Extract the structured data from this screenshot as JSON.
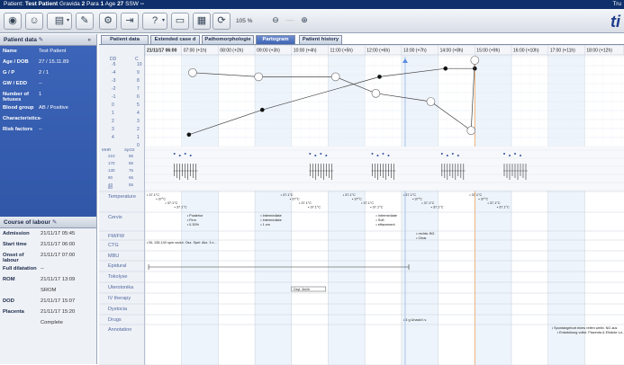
{
  "titlebar": {
    "prefix": "Patient: ",
    "name": "Test Patient",
    "g_label": "Gravida",
    "g": "2",
    "p_label": "Para",
    "p": "1",
    "age_label": "Age",
    "age": "27",
    "ssw_label": "SSW",
    "ssw": "--",
    "right": "Tru"
  },
  "toolbar": {
    "zoom": "105 %",
    "logo": "ti"
  },
  "sidebar": {
    "patient_header": "Patient data",
    "patient": [
      {
        "k": "Name",
        "v": "Test Patient"
      },
      {
        "k": "Age / DOB",
        "v": "27 / 15.11.89"
      },
      {
        "k": "G / P",
        "v": "2 / 1"
      },
      {
        "k": "GW / EDD",
        "v": "--"
      },
      {
        "k": "Number of fetuses",
        "v": "1"
      },
      {
        "k": "Blood group",
        "v": "AB / Positive"
      },
      {
        "k": "Characteristics",
        "v": "--"
      },
      {
        "k": "Risk factors",
        "v": "--"
      }
    ],
    "labour_header": "Course of labour",
    "labour": [
      {
        "k": "Admission",
        "v": "21/11/17 05:45"
      },
      {
        "k": "Start time",
        "v": "21/11/17 06:00"
      },
      {
        "k": "Onset of labour",
        "v": "21/11/17 07:00"
      },
      {
        "k": "Full dilatation",
        "v": "--"
      },
      {
        "k": "ROM",
        "v": "21/11/17 13:09"
      },
      {
        "k": "",
        "v": "SROM"
      },
      {
        "k": "DOD",
        "v": "21/11/17 15:07"
      },
      {
        "k": "Placenta",
        "v": "21/11/17 15:20"
      },
      {
        "k": "",
        "v": "Complete"
      }
    ]
  },
  "tabs": [
    "Patient data",
    "Extended case d",
    "Pathomorphologie",
    "Partogram",
    "Patient history"
  ],
  "active_tab": 3,
  "times": [
    "21/11/17 06:00",
    "07:00 (+1h)",
    "08:00 (+2h)",
    "09:00 (+3h)",
    "10:00 (+4h)",
    "11:00 (+5h)",
    "12:00 (+6h)",
    "13:00 (+7h)",
    "14:00 (+8h)",
    "15:00 (+9h)",
    "16:00 (+10h)",
    "17:00 (+11h)",
    "18:00 (+12h)"
  ],
  "dilation_axis": {
    "left_title": "DD",
    "right_title": "C",
    "left": [
      "-5",
      "-4",
      "-3",
      "-2",
      "-1",
      "0",
      "1",
      "2",
      "3",
      "4"
    ],
    "right": [
      "10",
      "9",
      "8",
      "7",
      "6",
      "5",
      "4",
      "3",
      "2",
      "1",
      "0"
    ]
  },
  "fhr_axis": {
    "title": "MHR",
    "legend": "SpO2",
    "left": [
      "210",
      "170",
      "130",
      "90",
      "40"
    ],
    "right": [
      "95",
      "85",
      "75",
      "65",
      "55"
    ],
    "bottom": "80"
  },
  "rows": [
    "Temperature",
    "Cervix",
    "FM/FW",
    "CTG",
    "MBU",
    "Epidural",
    "Tokolyse",
    "Uterotonika",
    "IV therapy",
    "Dystocia",
    "Drugs",
    "Annotation"
  ],
  "chart_data": {
    "type": "line",
    "x_unit": "hours from 06:00",
    "series": [
      {
        "values": [
          [
            1.2,
            1
          ],
          [
            3.2,
            4
          ],
          [
            6.4,
            8
          ],
          [
            8.2,
            9
          ],
          [
            9.0,
            9
          ]
        ]
      },
      {
        "values": [
          [
            1.3,
            8.5
          ],
          [
            3.1,
            8
          ],
          [
            5.2,
            8
          ],
          [
            6.3,
            6
          ],
          [
            7.8,
            5
          ],
          [
            8.9,
            1.5
          ],
          [
            9.0,
            10
          ]
        ]
      }
    ],
    "temperature": [
      {
        "t": 0.05,
        "v": "37.1°C"
      },
      {
        "t": 0.3,
        "v": "37°C"
      },
      {
        "t": 0.55,
        "v": "37.1°C"
      },
      {
        "t": 0.8,
        "v": "37.1°C"
      },
      {
        "t": 3.7,
        "v": "37.1°C"
      },
      {
        "t": 3.95,
        "v": "37°C"
      },
      {
        "t": 4.2,
        "v": "37.1°C"
      },
      {
        "t": 4.45,
        "v": "37.1°C"
      },
      {
        "t": 5.4,
        "v": "37.1°C"
      },
      {
        "t": 5.65,
        "v": "37°C"
      },
      {
        "t": 5.9,
        "v": "37.1°C"
      },
      {
        "t": 6.15,
        "v": "37.1°C"
      },
      {
        "t": 7.05,
        "v": "37.1°C"
      },
      {
        "t": 7.3,
        "v": "37°C"
      },
      {
        "t": 7.55,
        "v": "37.1°C"
      },
      {
        "t": 7.8,
        "v": "37.1°C"
      },
      {
        "t": 8.85,
        "v": "37.1°C"
      },
      {
        "t": 9.1,
        "v": "37°C"
      },
      {
        "t": 9.35,
        "v": "37.1°C"
      },
      {
        "t": 9.6,
        "v": "37.1°C"
      }
    ],
    "cervix": [
      {
        "t": 1.15,
        "lines": [
          "Posterior",
          "Firm",
          "0.30%"
        ]
      },
      {
        "t": 3.15,
        "lines": [
          "Intermediate",
          "Intermediate",
          "1 cm"
        ]
      },
      {
        "t": 6.3,
        "lines": [
          "Intermediate",
          "Soft",
          "effacement"
        ]
      }
    ],
    "fmfw": [
      {
        "t": 7.4,
        "lines": [
          "rechts: BG",
          "Clear"
        ]
      }
    ],
    "ctg": [
      {
        "t": 0.05,
        "v": "BL 135-140 spm undul. Osz. Spei: Akz. 3 x..."
      }
    ],
    "epidural": {
      "from": 0.1,
      "to": 7.2
    },
    "uterotonika": [
      {
        "t": 4.0,
        "v": "Oxyt. 3m/ih"
      }
    ],
    "drugs": [
      {
        "t": 7.05,
        "v": "3 g Unacid i.v."
      }
    ],
    "annotation": [
      {
        "t": 11.1,
        "lines": [
          "Spontangeburt eines reifen weibl. NG aus",
          "Entwicklung vollst. Plazenta & Eihäute Ld..."
        ]
      }
    ],
    "fhr_clusters": [
      1.0,
      4.7,
      6.4,
      8.3,
      10.0
    ]
  }
}
